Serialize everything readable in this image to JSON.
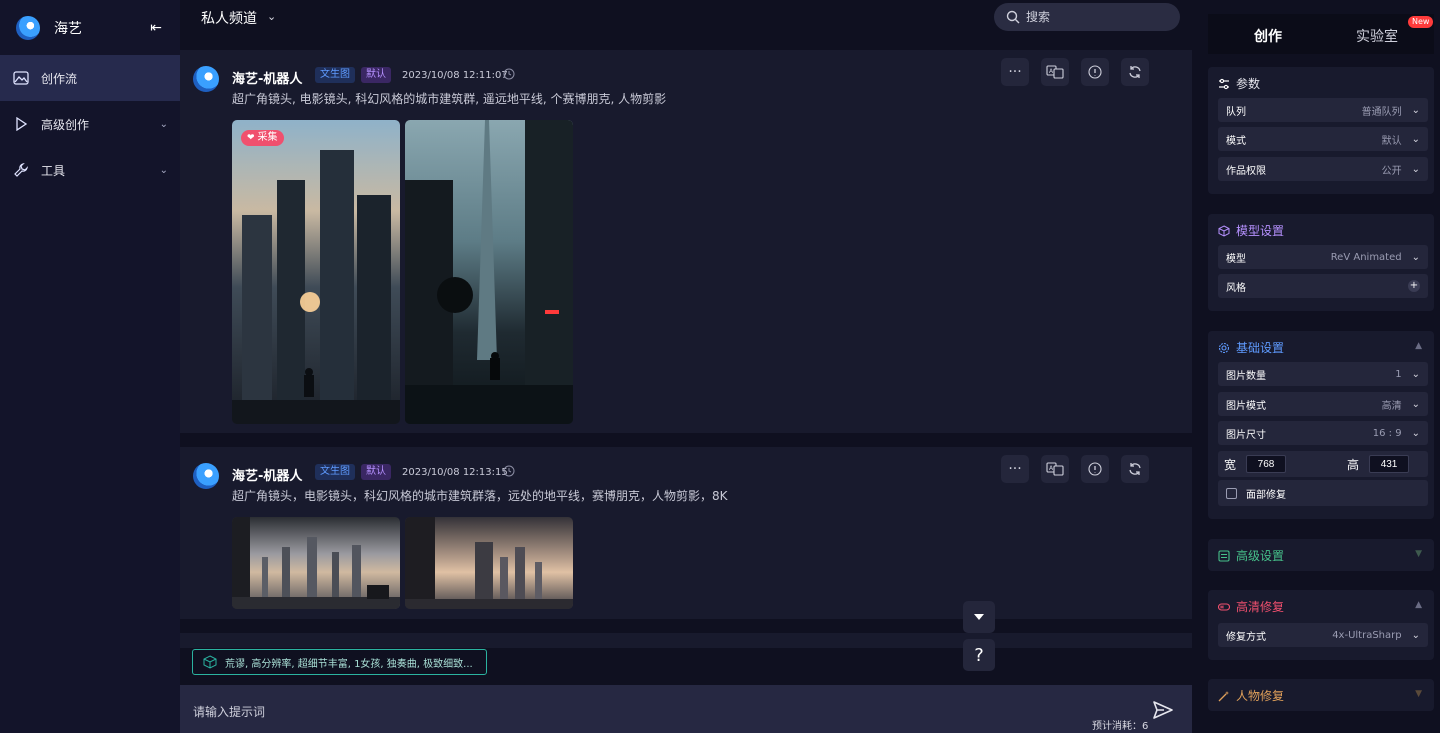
{
  "sidebar": {
    "brand": "海艺",
    "items": [
      {
        "label": "创作流",
        "active": true
      },
      {
        "label": "高级创作"
      },
      {
        "label": "工具"
      }
    ]
  },
  "topbar": {
    "channel": "私人频道",
    "search_placeholder": "搜索"
  },
  "posts": [
    {
      "author": "海艺-机器人",
      "tag_type": "文生图",
      "tag_mode": "默认",
      "time": "2023/10/08 12:11:07",
      "prompt": "超广角镜头, 电影镜头, 科幻风格的城市建筑群, 遥远地平线, 个赛博朋克, 人物剪影",
      "badge": "采集"
    },
    {
      "author": "海艺-机器人",
      "tag_type": "文生图",
      "tag_mode": "默认",
      "time": "2023/10/08 12:13:15",
      "prompt": "超广角镜头，电影镜头，科幻风格的城市建筑群落，远处的地平线，赛博朋克，人物剪影，8K"
    }
  ],
  "suggestion": "荒谬, 高分辨率, 超细节丰富, 1女孩, 独奏曲, 极致细致...",
  "input": {
    "placeholder": "请输入提示词",
    "cost": "预计消耗：6"
  },
  "help_label": "?",
  "right": {
    "tabs": {
      "create": "创作",
      "lab": "实验室",
      "new_badge": "New"
    },
    "params": {
      "title": "参数",
      "queue": {
        "label": "队列",
        "value": "普通队列"
      },
      "mode": {
        "label": "模式",
        "value": "默认"
      },
      "permission": {
        "label": "作品权限",
        "value": "公开"
      }
    },
    "model": {
      "title": "模型设置",
      "model": {
        "label": "模型",
        "value": "ReV Animated"
      },
      "style": {
        "label": "风格"
      }
    },
    "basic": {
      "title": "基础设置",
      "count": {
        "label": "图片数量",
        "value": "1"
      },
      "img_mode": {
        "label": "图片模式",
        "value": "高清"
      },
      "size": {
        "label": "图片尺寸",
        "value": "16 : 9"
      },
      "width_label": "宽",
      "width_value": "768",
      "height_label": "高",
      "height_value": "431",
      "face_fix": "面部修复"
    },
    "advanced": {
      "title": "高级设置"
    },
    "hires": {
      "title": "高清修复",
      "method": {
        "label": "修复方式",
        "value": "4x-UltraSharp"
      }
    },
    "person_fix": {
      "title": "人物修复"
    }
  },
  "colors": {
    "accent_blue": "#5f9bff",
    "accent_purple": "#b691ff",
    "accent_green": "#46c08a",
    "accent_pink": "#f0506e",
    "accent_orange": "#e0a05a"
  }
}
